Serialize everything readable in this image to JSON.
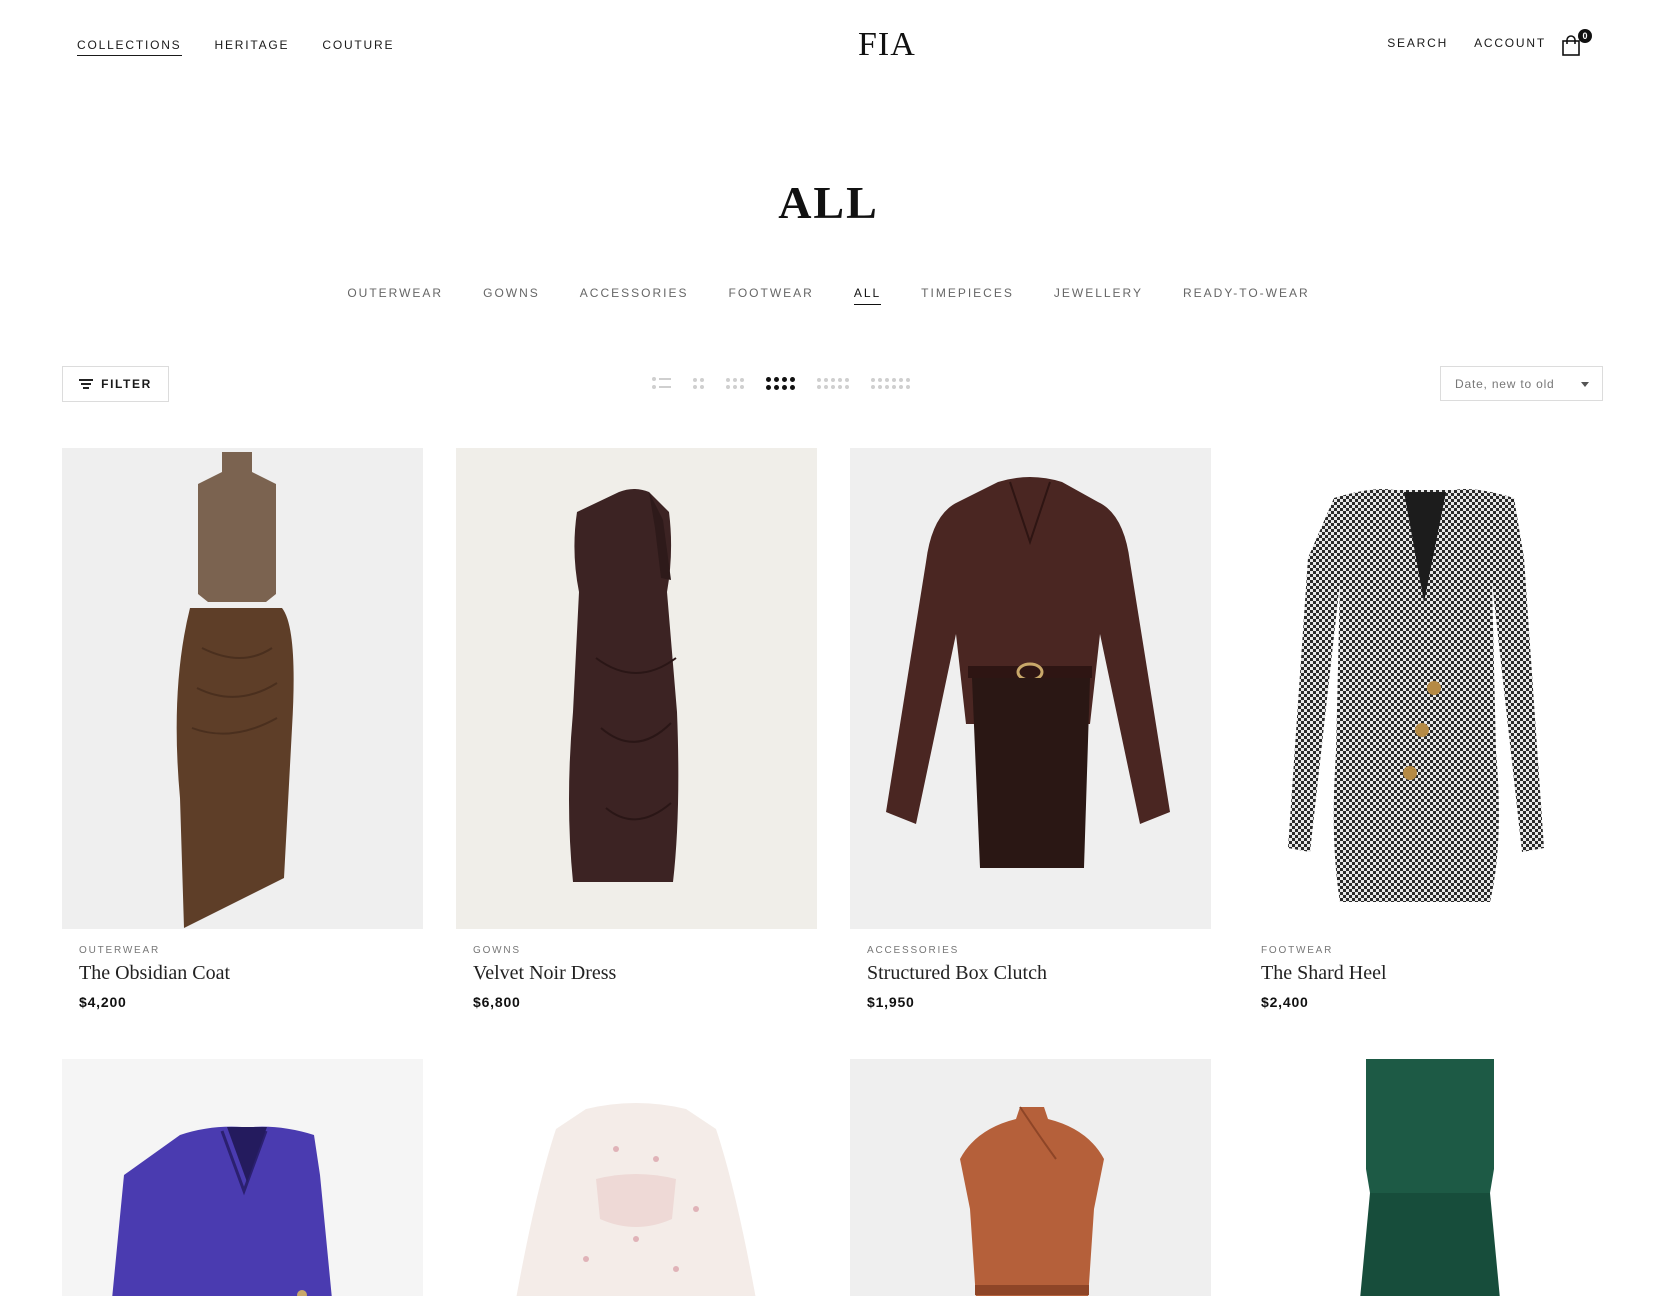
{
  "header": {
    "nav_left": [
      "COLLECTIONS",
      "HERITAGE",
      "COUTURE"
    ],
    "logo": "FIA",
    "nav_right": [
      "SEARCH",
      "ACCOUNT"
    ],
    "cart_count": "0"
  },
  "page": {
    "title": "ALL"
  },
  "categories": [
    "OUTERWEAR",
    "GOWNS",
    "ACCESSORIES",
    "FOOTWEAR",
    "ALL",
    "TIMEPIECES",
    "JEWELLERY",
    "READY-TO-WEAR"
  ],
  "toolbar": {
    "filter_label": "FILTER",
    "sort_value": "Date, new to old"
  },
  "products": [
    {
      "category": "OUTERWEAR",
      "title": "The Obsidian Coat",
      "price": "$4,200"
    },
    {
      "category": "GOWNS",
      "title": "Velvet Noir Dress",
      "price": "$6,800"
    },
    {
      "category": "ACCESSORIES",
      "title": "Structured Box Clutch",
      "price": "$1,950"
    },
    {
      "category": "FOOTWEAR",
      "title": "The Shard Heel",
      "price": "$2,400"
    },
    {
      "category": "",
      "title": "",
      "price": ""
    },
    {
      "category": "",
      "title": "",
      "price": ""
    },
    {
      "category": "",
      "title": "",
      "price": ""
    },
    {
      "category": "",
      "title": "",
      "price": ""
    }
  ],
  "colors": {
    "text": "#1a1a1a",
    "muted": "#777777",
    "border": "#dcdcdc",
    "image_bg_gray": "#efefef",
    "image_bg_cream": "#f0eee9"
  }
}
